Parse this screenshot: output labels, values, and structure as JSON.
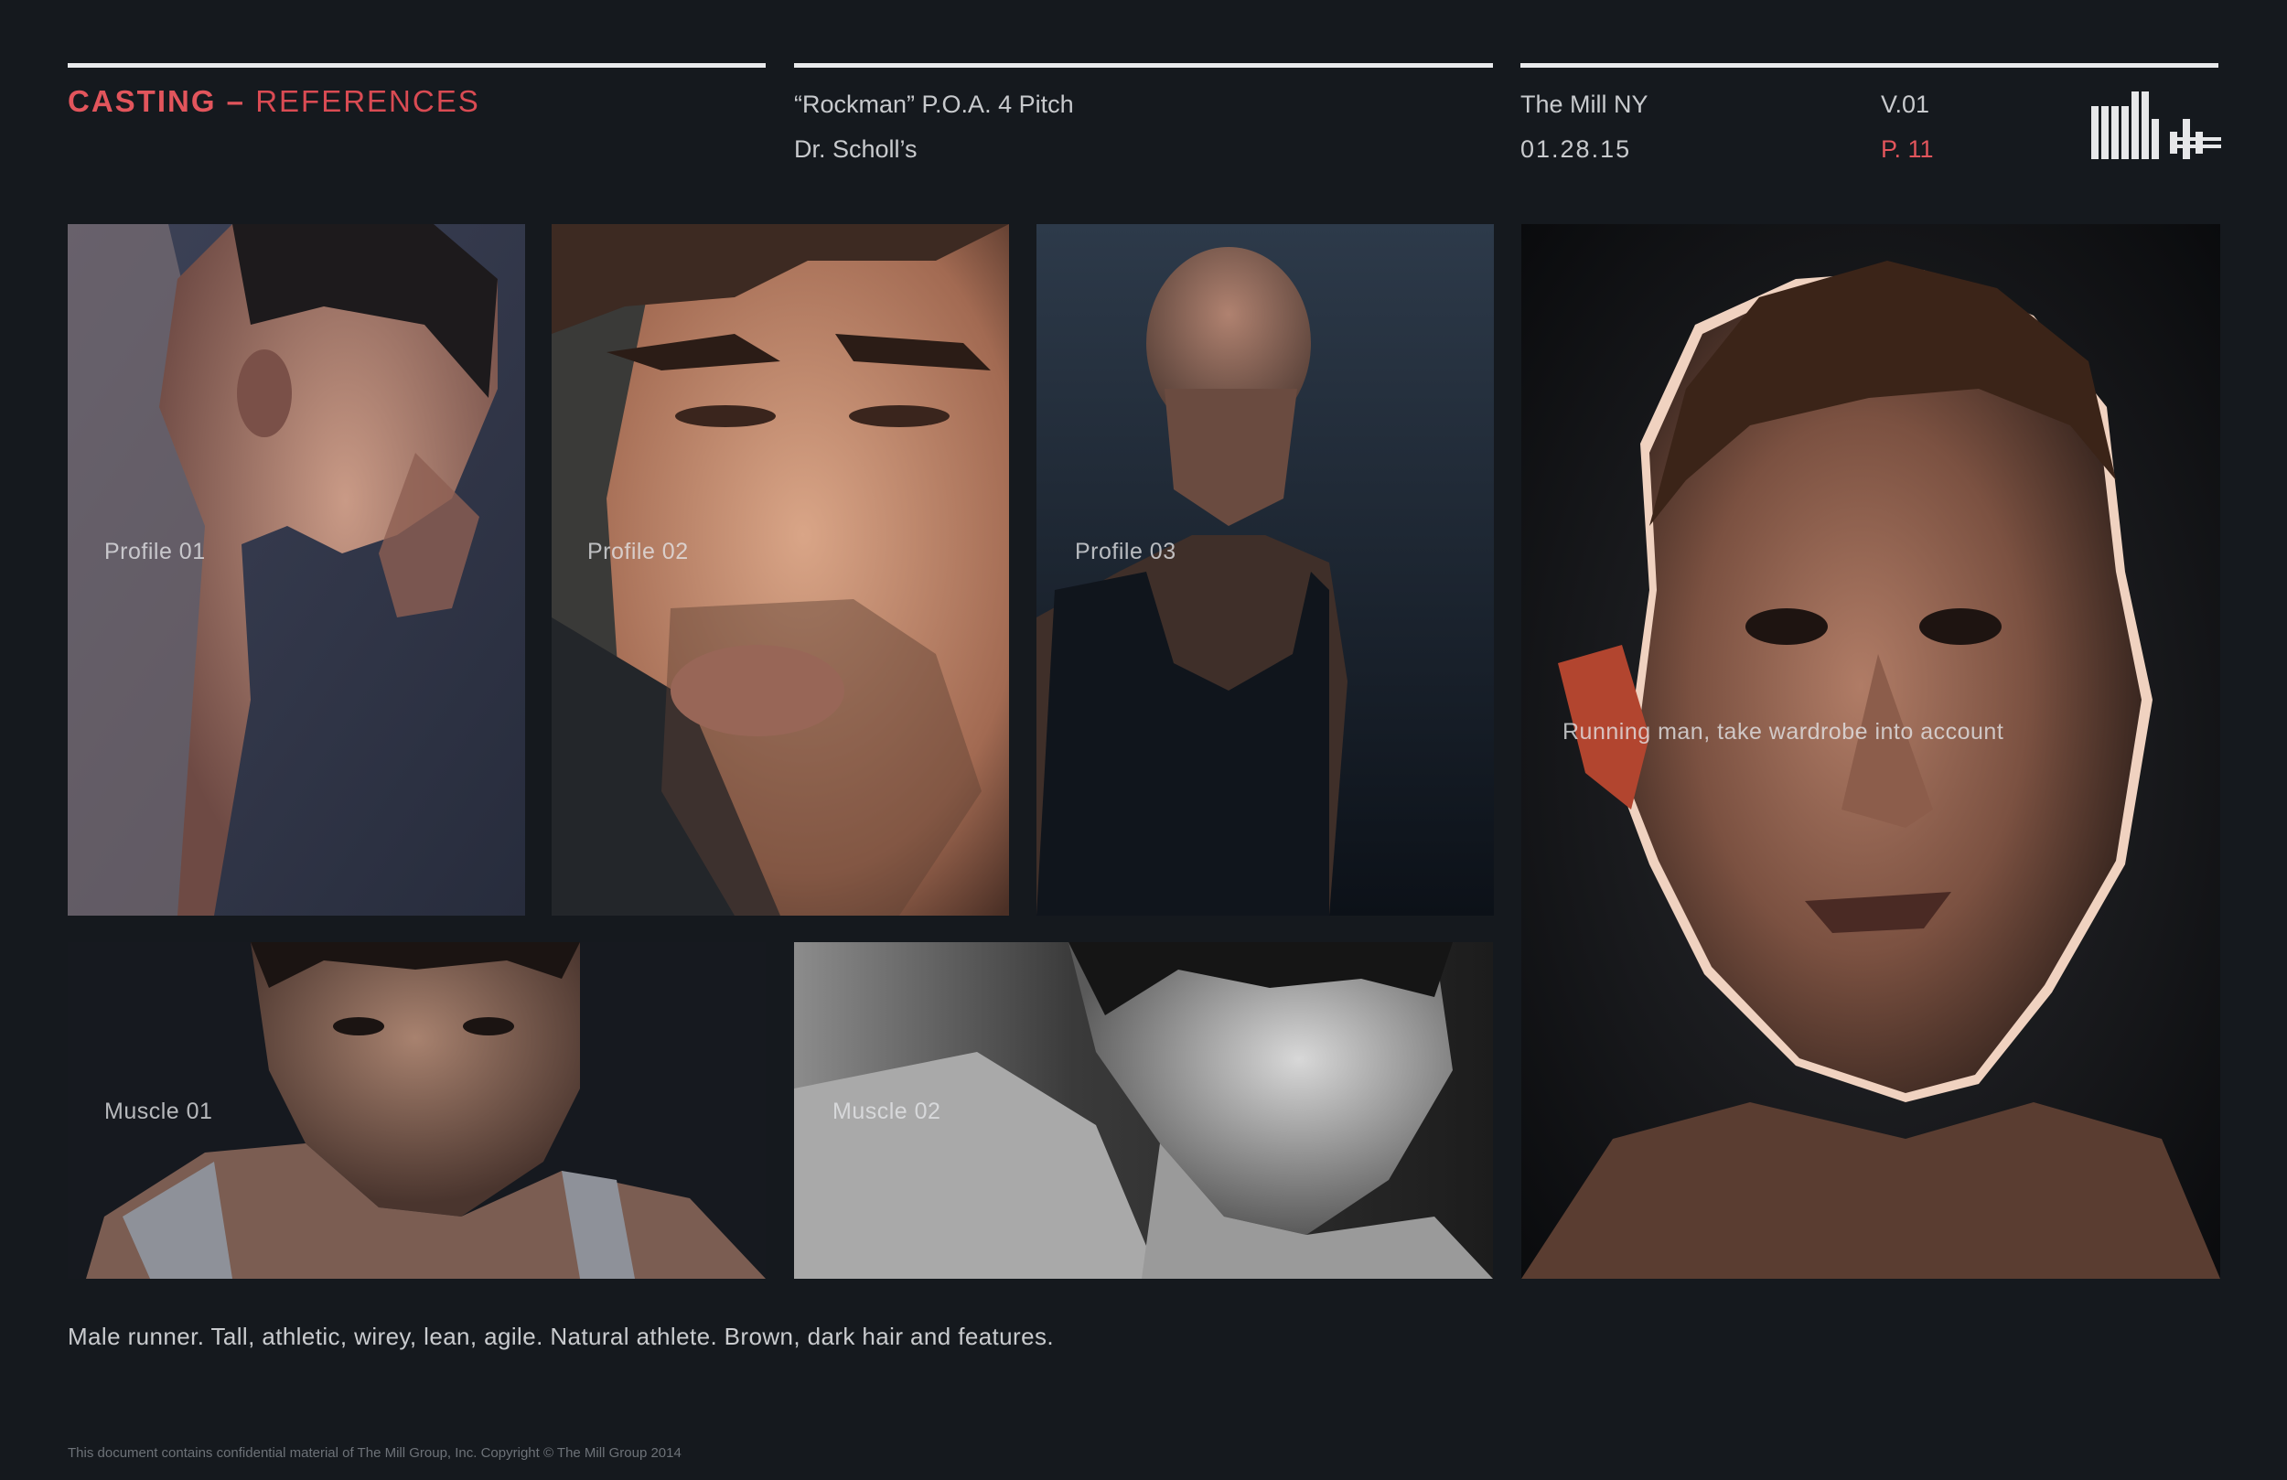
{
  "header": {
    "section_title_strong": "CASTING –",
    "section_title_light": "REFERENCES",
    "project_title": "“Rockman” P.O.A. 4 Pitch",
    "client": "Dr. Scholl’s",
    "studio": "The Mill NY",
    "date": "01.28.15",
    "version": "V.01",
    "page": "P. 11"
  },
  "photos": {
    "profile_01": {
      "label": "Profile 01",
      "icon": "man-head-tilted-portrait"
    },
    "profile_02": {
      "label": "Profile 02",
      "icon": "man-closeup-hooded-portrait"
    },
    "profile_03": {
      "label": "Profile 03",
      "icon": "bald-man-tank-top-portrait"
    },
    "muscle_01": {
      "label": "Muscle 01",
      "icon": "man-tank-top-portrait"
    },
    "muscle_02": {
      "label": "Muscle 02",
      "icon": "man-black-white-portrait"
    },
    "running_man": {
      "label": "Running man, take wardrobe into account",
      "icon": "man-backlit-closeup-portrait"
    }
  },
  "description": "Male runner. Tall, athletic, wirey, lean, agile. Natural athlete. Brown, dark hair and features.",
  "footer": "This document contains confidential material of The Mill Group, Inc. Copyright © The Mill Group 2014",
  "colors": {
    "background": "#15191e",
    "accent_red": "#e2555c",
    "rule": "#e9eaec"
  }
}
